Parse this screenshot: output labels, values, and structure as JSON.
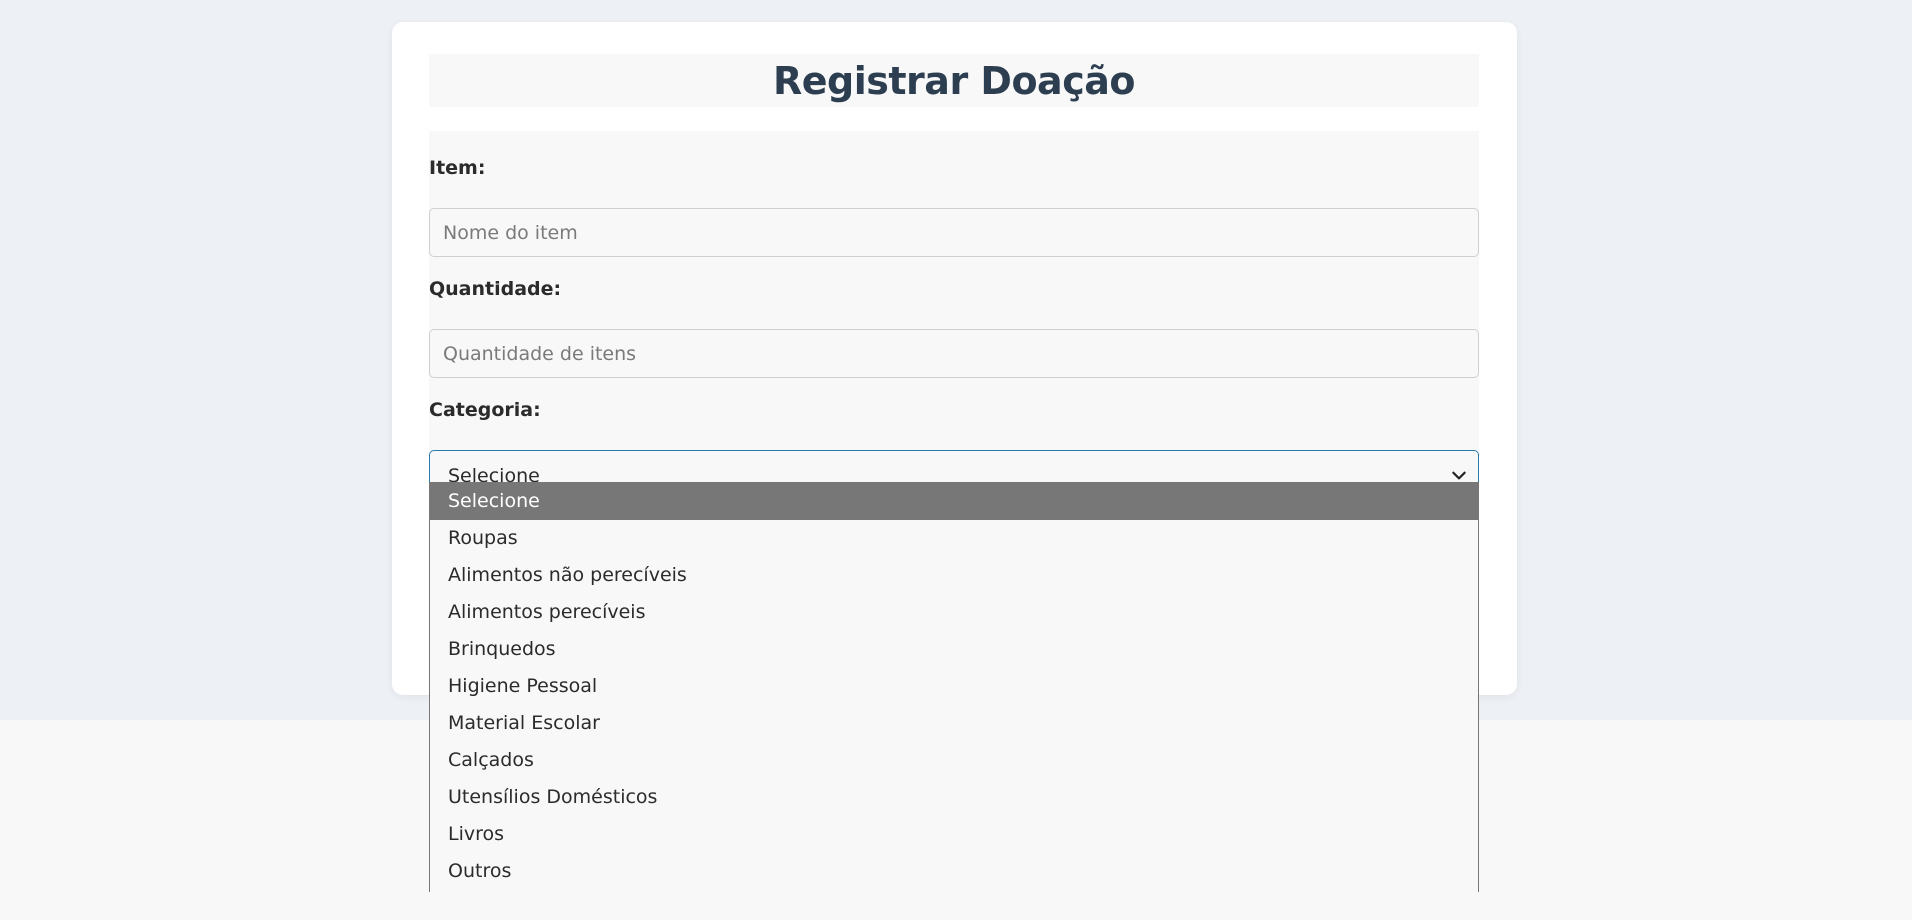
{
  "form": {
    "title": "Registrar Doação",
    "item_label": "Item:",
    "item_placeholder": "Nome do item",
    "quantity_label": "Quantidade:",
    "quantity_placeholder": "Quantidade de itens",
    "category_label": "Categoria:",
    "category_selected": "Selecione"
  },
  "dropdown": {
    "options": [
      "Selecione",
      "Roupas",
      "Alimentos não perecíveis",
      "Alimentos perecíveis",
      "Brinquedos",
      "Higiene Pessoal",
      "Material Escolar",
      "Calçados",
      "Utensílios Domésticos",
      "Livros",
      "Outros"
    ],
    "highlighted_index": 0
  },
  "icons": {
    "select_arrow": "chevron-down-icon"
  },
  "colors": {
    "page_background": "#edf0f5",
    "title_text": "#2c3e50",
    "select_focus_border": "#2a7ab0",
    "option_highlight": "#777777"
  }
}
